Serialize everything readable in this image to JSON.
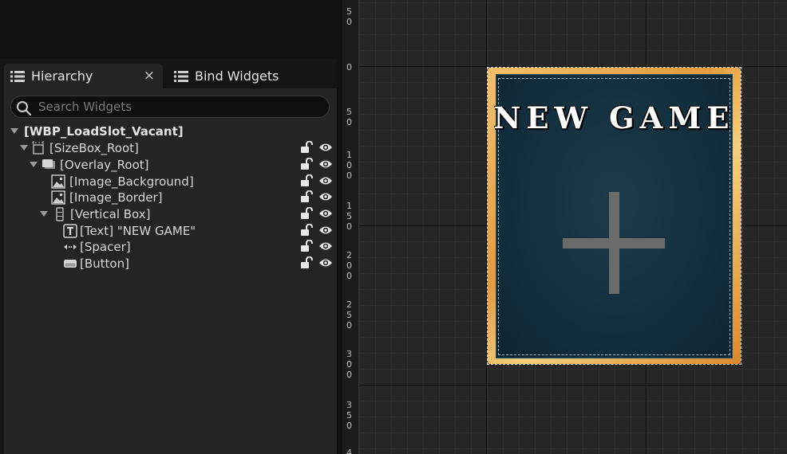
{
  "tabs": {
    "hierarchy": {
      "label": "Hierarchy",
      "close": "×",
      "icon": "list-icon"
    },
    "bind": {
      "label": "Bind Widgets",
      "icon": "list-icon"
    }
  },
  "search": {
    "placeholder": "Search Widgets"
  },
  "tree": {
    "root": {
      "label": "[WBP_LoadSlot_Vacant]"
    },
    "items": [
      {
        "label": "[SizeBox_Root]",
        "icon": "sizebox-icon"
      },
      {
        "label": "[Overlay_Root]",
        "icon": "overlay-icon"
      },
      {
        "label": "[Image_Background]",
        "icon": "image-icon"
      },
      {
        "label": "[Image_Border]",
        "icon": "image-icon"
      },
      {
        "label": "[Vertical Box]",
        "icon": "vertical-box-icon"
      },
      {
        "label": "[Text] \"NEW GAME\"",
        "icon": "text-icon"
      },
      {
        "label": "[Spacer]",
        "icon": "spacer-icon"
      },
      {
        "label": "[Button]",
        "icon": "button-icon"
      }
    ]
  },
  "ruler": {
    "ticks": [
      [
        "5",
        "0"
      ],
      [
        "0"
      ],
      [
        "5",
        "0"
      ],
      [
        "1",
        "0",
        "0"
      ],
      [
        "1",
        "5",
        "0"
      ],
      [
        "2",
        "0",
        "0"
      ],
      [
        "2",
        "5",
        "0"
      ],
      [
        "3",
        "0",
        "0"
      ],
      [
        "3",
        "5",
        "0"
      ],
      [
        "4"
      ]
    ]
  },
  "canvas": {
    "card_title": "NEW GAME",
    "accent_gold": "#f0b456",
    "card_blue": "#13303f"
  }
}
